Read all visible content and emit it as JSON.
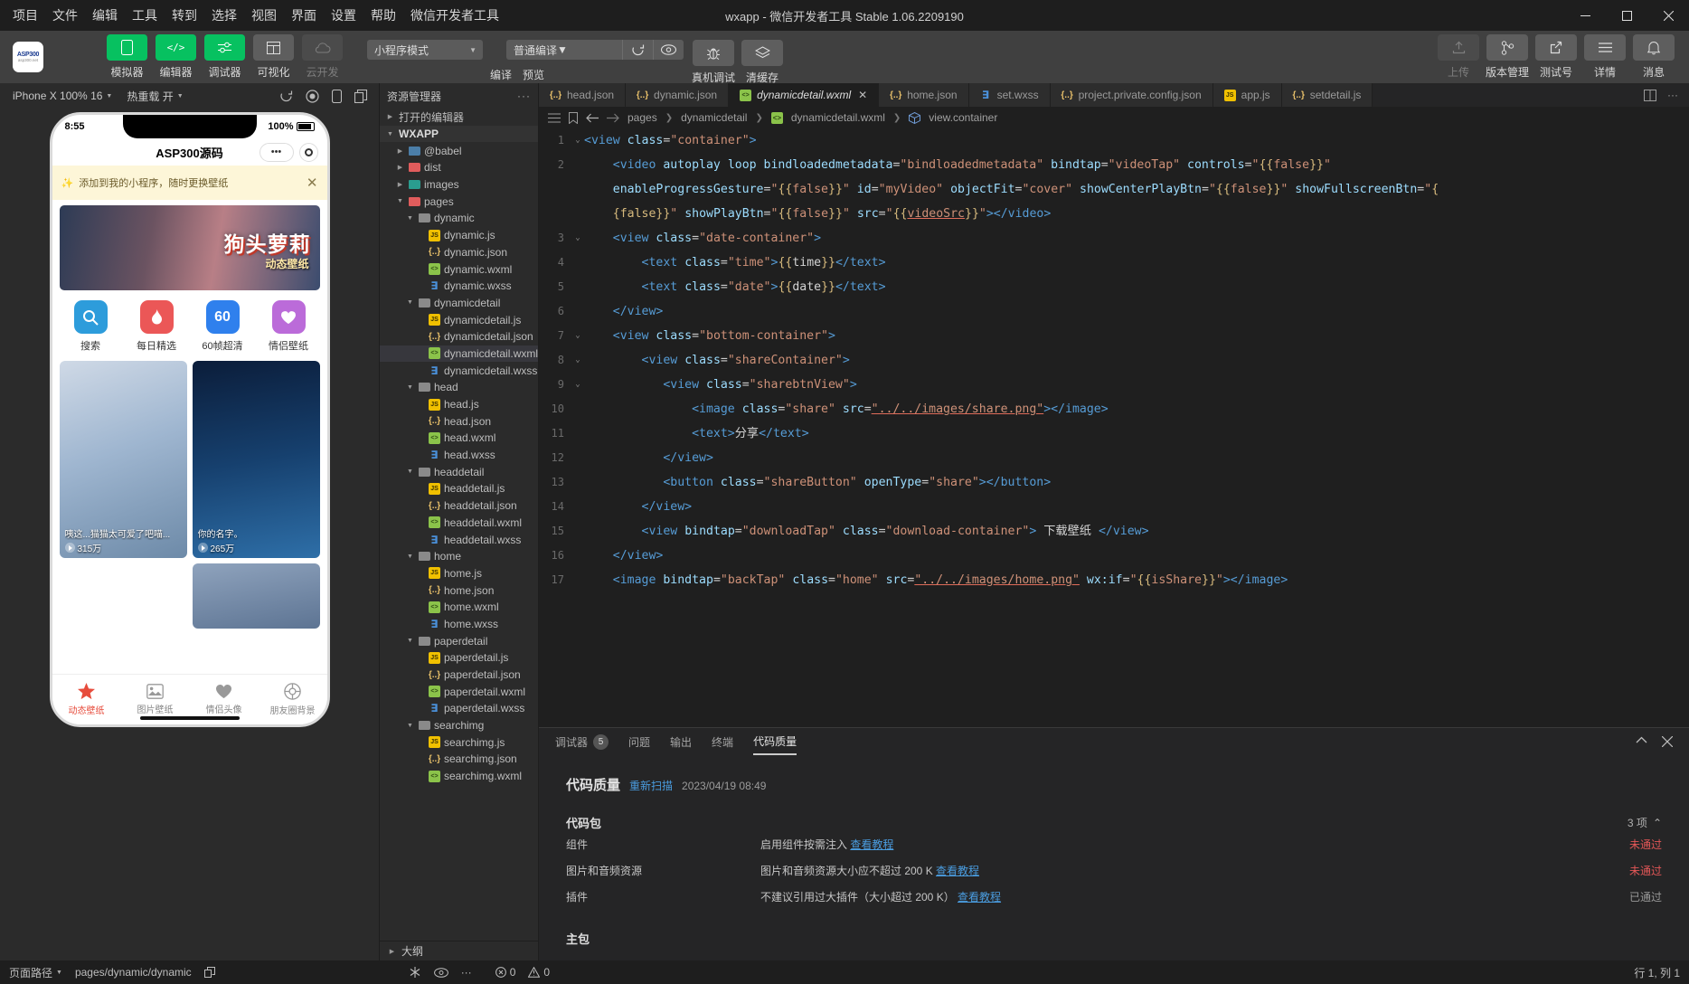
{
  "window": {
    "title": "wxapp - 微信开发者工具 Stable 1.06.2209190",
    "menu": [
      "项目",
      "文件",
      "编辑",
      "工具",
      "转到",
      "选择",
      "视图",
      "界面",
      "设置",
      "帮助",
      "微信开发者工具"
    ],
    "controls": {
      "minimize": "—",
      "maximize": "▢",
      "close": "✕"
    }
  },
  "logo": {
    "line1": "ASP300",
    "line2": "asp300.net"
  },
  "toolbar": {
    "left_buttons": [
      {
        "label": "模拟器",
        "icon": "phone-icon",
        "state": "active"
      },
      {
        "label": "编辑器",
        "icon": "code-icon",
        "state": "active"
      },
      {
        "label": "调试器",
        "icon": "sliders-icon",
        "state": "active"
      },
      {
        "label": "可视化",
        "icon": "layout-icon",
        "state": "normal"
      },
      {
        "label": "云开发",
        "icon": "cloud-icon",
        "state": "disabled"
      }
    ],
    "mode_select": "小程序模式",
    "compile_select": "普通编译",
    "mid_labels": [
      "编译",
      "预览",
      "真机调试",
      "清缓存"
    ],
    "debug_label": "真机调试",
    "cache_label": "清缓存",
    "right_buttons": [
      {
        "label": "上传",
        "icon": "upload-icon",
        "state": "disabled"
      },
      {
        "label": "版本管理",
        "icon": "branch-icon",
        "state": "normal"
      },
      {
        "label": "测试号",
        "icon": "external-link-icon",
        "state": "normal"
      },
      {
        "label": "详情",
        "icon": "menu-icon",
        "state": "normal"
      },
      {
        "label": "消息",
        "icon": "bell-icon",
        "state": "normal"
      }
    ]
  },
  "simulator": {
    "device": "iPhone X 100% 16",
    "hot_reload": "热重载 开",
    "icons": [
      "rotate-icon",
      "record-icon",
      "phone-icon",
      "copy-icon"
    ],
    "phone": {
      "time": "8:55",
      "battery": "100%",
      "nav_title": "ASP300源码",
      "tip_text": "添加到我的小程序，随时更换壁纸",
      "banner_title": "狗头萝莉",
      "banner_sub": "动态壁纸",
      "quick": [
        {
          "label": "搜索",
          "icon": "search-icon",
          "color": "#2d9cdb"
        },
        {
          "label": "每日精选",
          "icon": "flame-icon",
          "color": "#eb5757"
        },
        {
          "label": "60帧超清",
          "icon": "sixty-icon",
          "color": "#2f80ed"
        },
        {
          "label": "情侣壁纸",
          "icon": "heart-icon",
          "color": "#bb6bd9"
        }
      ],
      "cards": [
        {
          "title": "咦这...猫猫太可爱了吧喵...",
          "plays": "315万",
          "grad": "linear-gradient(160deg,#cfd9e6,#9fb6d0 45%,#6d8aa8)"
        },
        {
          "title": "你的名字。",
          "plays": "265万",
          "grad": "linear-gradient(170deg,#0b1d3a,#16406e 50%,#2e6fa8)"
        },
        {
          "title": "",
          "plays": "",
          "grad": "linear-gradient(170deg,#8fa3bd,#5d7493)"
        }
      ],
      "tabbar": [
        {
          "label": "动态壁纸",
          "icon": "wallpaper-icon",
          "active": true
        },
        {
          "label": "图片壁纸",
          "icon": "image-icon",
          "active": false
        },
        {
          "label": "情侣头像",
          "icon": "heart-icon",
          "active": false
        },
        {
          "label": "朋友圈背景",
          "icon": "circle-icon",
          "active": false
        }
      ]
    }
  },
  "explorer": {
    "title": "资源管理器",
    "more": "···",
    "open_editors": "打开的编辑器",
    "root": "WXAPP",
    "outline": "大纲",
    "tree": [
      {
        "label": "@babel",
        "type": "folder",
        "depth": 1,
        "open": false,
        "color": "#4b7ea8"
      },
      {
        "label": "dist",
        "type": "folder",
        "depth": 1,
        "open": false,
        "color": "#e05c5c"
      },
      {
        "label": "images",
        "type": "folder",
        "depth": 1,
        "open": false,
        "color": "#2a9d8f"
      },
      {
        "label": "pages",
        "type": "folder",
        "depth": 1,
        "open": true,
        "color": "#e05c5c"
      },
      {
        "label": "dynamic",
        "type": "folder",
        "depth": 2,
        "open": true,
        "color": "#8a8a8a"
      },
      {
        "label": "dynamic.js",
        "type": "js",
        "depth": 3
      },
      {
        "label": "dynamic.json",
        "type": "json",
        "depth": 3
      },
      {
        "label": "dynamic.wxml",
        "type": "wxml",
        "depth": 3
      },
      {
        "label": "dynamic.wxss",
        "type": "wxss",
        "depth": 3
      },
      {
        "label": "dynamicdetail",
        "type": "folder",
        "depth": 2,
        "open": true,
        "color": "#8a8a8a"
      },
      {
        "label": "dynamicdetail.js",
        "type": "js",
        "depth": 3
      },
      {
        "label": "dynamicdetail.json",
        "type": "json",
        "depth": 3
      },
      {
        "label": "dynamicdetail.wxml",
        "type": "wxml",
        "depth": 3,
        "selected": true
      },
      {
        "label": "dynamicdetail.wxss",
        "type": "wxss",
        "depth": 3
      },
      {
        "label": "head",
        "type": "folder",
        "depth": 2,
        "open": true,
        "color": "#8a8a8a"
      },
      {
        "label": "head.js",
        "type": "js",
        "depth": 3
      },
      {
        "label": "head.json",
        "type": "json",
        "depth": 3
      },
      {
        "label": "head.wxml",
        "type": "wxml",
        "depth": 3
      },
      {
        "label": "head.wxss",
        "type": "wxss",
        "depth": 3
      },
      {
        "label": "headdetail",
        "type": "folder",
        "depth": 2,
        "open": true,
        "color": "#8a8a8a"
      },
      {
        "label": "headdetail.js",
        "type": "js",
        "depth": 3
      },
      {
        "label": "headdetail.json",
        "type": "json",
        "depth": 3
      },
      {
        "label": "headdetail.wxml",
        "type": "wxml",
        "depth": 3
      },
      {
        "label": "headdetail.wxss",
        "type": "wxss",
        "depth": 3
      },
      {
        "label": "home",
        "type": "folder",
        "depth": 2,
        "open": true,
        "color": "#8a8a8a"
      },
      {
        "label": "home.js",
        "type": "js",
        "depth": 3
      },
      {
        "label": "home.json",
        "type": "json",
        "depth": 3
      },
      {
        "label": "home.wxml",
        "type": "wxml",
        "depth": 3
      },
      {
        "label": "home.wxss",
        "type": "wxss",
        "depth": 3
      },
      {
        "label": "paperdetail",
        "type": "folder",
        "depth": 2,
        "open": true,
        "color": "#8a8a8a"
      },
      {
        "label": "paperdetail.js",
        "type": "js",
        "depth": 3
      },
      {
        "label": "paperdetail.json",
        "type": "json",
        "depth": 3
      },
      {
        "label": "paperdetail.wxml",
        "type": "wxml",
        "depth": 3
      },
      {
        "label": "paperdetail.wxss",
        "type": "wxss",
        "depth": 3
      },
      {
        "label": "searchimg",
        "type": "folder",
        "depth": 2,
        "open": true,
        "color": "#8a8a8a"
      },
      {
        "label": "searchimg.js",
        "type": "js",
        "depth": 3
      },
      {
        "label": "searchimg.json",
        "type": "json",
        "depth": 3
      },
      {
        "label": "searchimg.wxml",
        "type": "wxml",
        "depth": 3
      }
    ]
  },
  "editor": {
    "tabs": [
      {
        "label": "head.json",
        "type": "json",
        "active": false
      },
      {
        "label": "dynamic.json",
        "type": "json",
        "active": false
      },
      {
        "label": "dynamicdetail.wxml",
        "type": "wxml",
        "active": true,
        "close": "✕"
      },
      {
        "label": "home.json",
        "type": "json",
        "active": false
      },
      {
        "label": "set.wxss",
        "type": "wxss",
        "active": false
      },
      {
        "label": "project.private.config.json",
        "type": "json",
        "active": false
      },
      {
        "label": "app.js",
        "type": "js",
        "active": false
      },
      {
        "label": "setdetail.js",
        "type": "json",
        "active": false
      }
    ],
    "tab_tools": [
      "split-editor-icon",
      "more-icon"
    ],
    "breadcrumb": [
      "pages",
      "dynamicdetail",
      "dynamicdetail.wxml",
      "view.container"
    ],
    "breadcrumb_icons": [
      "list-icon",
      "bookmark-icon",
      "arrow-left-icon",
      "arrow-right-icon"
    ],
    "lines": [
      {
        "n": "1",
        "fold": "⌄",
        "html": "<span class='t-tag'>&lt;view</span> <span class='t-attr'>class</span>=<span class='t-str'>\"container\"</span><span class='t-tag'>&gt;</span>"
      },
      {
        "n": "2",
        "fold": "",
        "html": "&nbsp;&nbsp;&nbsp;&nbsp;<span class='t-tag'>&lt;video</span> <span class='t-attr'>autoplay loop bindloadedmetadata</span>=<span class='t-str'>\"bindloadedmetadata\"</span> <span class='t-attr'>bindtap</span>=<span class='t-str'>\"videoTap\"</span> <span class='t-attr'>controls</span>=<span class='t-str'>\"</span><span class='t-br'>{{</span><span class='t-str'>false</span><span class='t-br'>}}</span><span class='t-str'>\"</span>"
      },
      {
        "n": "",
        "fold": "",
        "html": "&nbsp;&nbsp;&nbsp;&nbsp;<span class='t-attr'>enableProgressGesture</span>=<span class='t-str'>\"</span><span class='t-br'>{{</span><span class='t-str'>false</span><span class='t-br'>}}</span><span class='t-str'>\"</span> <span class='t-attr'>id</span>=<span class='t-str'>\"myVideo\"</span> <span class='t-attr'>objectFit</span>=<span class='t-str'>\"cover\"</span> <span class='t-attr'>showCenterPlayBtn</span>=<span class='t-str'>\"</span><span class='t-br'>{{</span><span class='t-str'>false</span><span class='t-br'>}}</span><span class='t-str'>\"</span> <span class='t-attr'>showFullscreenBtn</span>=<span class='t-str'>\"</span><span class='t-br'>{</span>"
      },
      {
        "n": "",
        "fold": "",
        "html": "&nbsp;&nbsp;&nbsp;&nbsp;<span class='t-br'>{false}}</span><span class='t-str'>\"</span> <span class='t-attr'>showPlayBtn</span>=<span class='t-str'>\"</span><span class='t-br'>{{</span><span class='t-str'>false</span><span class='t-br'>}}</span><span class='t-str'>\"</span> <span class='t-attr'>src</span>=<span class='t-str'>\"</span><span class='t-br'>{{</span><span class='t-str und'>videoSrc</span><span class='t-br'>}}</span><span class='t-str'>\"</span><span class='t-tag'>&gt;&lt;/video&gt;</span>"
      },
      {
        "n": "3",
        "fold": "⌄",
        "html": "&nbsp;&nbsp;&nbsp;&nbsp;<span class='t-tag'>&lt;view</span> <span class='t-attr'>class</span>=<span class='t-str'>\"date-container\"</span><span class='t-tag'>&gt;</span>"
      },
      {
        "n": "4",
        "fold": "",
        "html": "&nbsp;&nbsp;&nbsp;&nbsp;&nbsp;&nbsp;&nbsp;&nbsp;<span class='t-tag'>&lt;text</span> <span class='t-attr'>class</span>=<span class='t-str'>\"time\"</span><span class='t-tag'>&gt;</span><span class='t-br'>{{</span><span class='t-txt'>time</span><span class='t-br'>}}</span><span class='t-tag'>&lt;/text&gt;</span>"
      },
      {
        "n": "5",
        "fold": "",
        "html": "&nbsp;&nbsp;&nbsp;&nbsp;&nbsp;&nbsp;&nbsp;&nbsp;<span class='t-tag'>&lt;text</span> <span class='t-attr'>class</span>=<span class='t-str'>\"date\"</span><span class='t-tag'>&gt;</span><span class='t-br'>{{</span><span class='t-txt'>date</span><span class='t-br'>}}</span><span class='t-tag'>&lt;/text&gt;</span>"
      },
      {
        "n": "6",
        "fold": "",
        "html": "&nbsp;&nbsp;&nbsp;&nbsp;<span class='t-tag'>&lt;/view&gt;</span>"
      },
      {
        "n": "7",
        "fold": "⌄",
        "html": "&nbsp;&nbsp;&nbsp;&nbsp;<span class='t-tag'>&lt;view</span> <span class='t-attr'>class</span>=<span class='t-str'>\"bottom-container\"</span><span class='t-tag'>&gt;</span>"
      },
      {
        "n": "8",
        "fold": "⌄",
        "html": "&nbsp;&nbsp;&nbsp;&nbsp;&nbsp;&nbsp;&nbsp;&nbsp;<span class='t-tag'>&lt;view</span> <span class='t-attr'>class</span>=<span class='t-str'>\"shareContainer\"</span><span class='t-tag'>&gt;</span>"
      },
      {
        "n": "9",
        "fold": "⌄",
        "html": "&nbsp;&nbsp;&nbsp;&nbsp;&nbsp;&nbsp;&nbsp;&nbsp;&nbsp;&nbsp;&nbsp;<span class='t-tag'>&lt;view</span> <span class='t-attr'>class</span>=<span class='t-str'>\"sharebtnView\"</span><span class='t-tag'>&gt;</span>"
      },
      {
        "n": "10",
        "fold": "",
        "html": "&nbsp;&nbsp;&nbsp;&nbsp;&nbsp;&nbsp;&nbsp;&nbsp;&nbsp;&nbsp;&nbsp;&nbsp;&nbsp;&nbsp;&nbsp;<span class='t-tag'>&lt;image</span> <span class='t-attr'>class</span>=<span class='t-str'>\"share\"</span> <span class='t-attr'>src</span>=<span class='t-str und'>\"../../images/share.png\"</span><span class='t-tag'>&gt;&lt;/image&gt;</span>"
      },
      {
        "n": "11",
        "fold": "",
        "html": "&nbsp;&nbsp;&nbsp;&nbsp;&nbsp;&nbsp;&nbsp;&nbsp;&nbsp;&nbsp;&nbsp;&nbsp;&nbsp;&nbsp;&nbsp;<span class='t-tag'>&lt;text&gt;</span><span class='t-txt'>分享</span><span class='t-tag'>&lt;/text&gt;</span>"
      },
      {
        "n": "12",
        "fold": "",
        "html": "&nbsp;&nbsp;&nbsp;&nbsp;&nbsp;&nbsp;&nbsp;&nbsp;&nbsp;&nbsp;&nbsp;<span class='t-tag'>&lt;/view&gt;</span>"
      },
      {
        "n": "13",
        "fold": "",
        "html": "&nbsp;&nbsp;&nbsp;&nbsp;&nbsp;&nbsp;&nbsp;&nbsp;&nbsp;&nbsp;&nbsp;<span class='t-tag'>&lt;button</span> <span class='t-attr'>class</span>=<span class='t-str'>\"shareButton\"</span> <span class='t-attr'>openType</span>=<span class='t-str'>\"share\"</span><span class='t-tag'>&gt;&lt;/button&gt;</span>"
      },
      {
        "n": "14",
        "fold": "",
        "html": "&nbsp;&nbsp;&nbsp;&nbsp;&nbsp;&nbsp;&nbsp;&nbsp;<span class='t-tag'>&lt;/view&gt;</span>"
      },
      {
        "n": "15",
        "fold": "",
        "html": "&nbsp;&nbsp;&nbsp;&nbsp;&nbsp;&nbsp;&nbsp;&nbsp;<span class='t-tag'>&lt;view</span> <span class='t-attr'>bindtap</span>=<span class='t-str'>\"downloadTap\"</span> <span class='t-attr'>class</span>=<span class='t-str'>\"download-container\"</span><span class='t-tag'>&gt;</span> <span class='t-txt'>下载壁纸</span> <span class='t-tag'>&lt;/view&gt;</span>"
      },
      {
        "n": "16",
        "fold": "",
        "html": "&nbsp;&nbsp;&nbsp;&nbsp;<span class='t-tag'>&lt;/view&gt;</span>"
      },
      {
        "n": "17",
        "fold": "",
        "html": "&nbsp;&nbsp;&nbsp;&nbsp;<span class='t-tag'>&lt;image</span> <span class='t-attr'>bindtap</span>=<span class='t-str'>\"backTap\"</span> <span class='t-attr'>class</span>=<span class='t-str'>\"home\"</span> <span class='t-attr'>src</span>=<span class='t-str und'>\"../../images/home.png\"</span> <span class='t-attr'>wx:if</span>=<span class='t-str'>\"</span><span class='t-br'>{{</span><span class='t-str'>isShare</span><span class='t-br'>}}</span><span class='t-str'>\"</span><span class='t-tag'>&gt;&lt;/image&gt;</span>"
      }
    ]
  },
  "panel": {
    "tabs": [
      {
        "label": "调试器",
        "badge": "5",
        "active": false
      },
      {
        "label": "问题",
        "badge": "",
        "active": false
      },
      {
        "label": "输出",
        "badge": "",
        "active": false
      },
      {
        "label": "终端",
        "badge": "",
        "active": false
      },
      {
        "label": "代码质量",
        "badge": "",
        "active": true
      }
    ],
    "controls": [
      "collapse-icon",
      "close-icon"
    ],
    "quality": {
      "title": "代码质量",
      "rescan": "重新扫描",
      "timestamp": "2023/04/19 08:49",
      "section1": {
        "name": "代码包",
        "count": "3 项"
      },
      "rows": [
        {
          "name": "组件",
          "desc": "启用组件按需注入",
          "link": "查看教程",
          "status": "未通过",
          "ok": false
        },
        {
          "name": "图片和音频资源",
          "desc": "图片和音频资源大小应不超过 200 K",
          "link": "查看教程",
          "status": "未通过",
          "ok": false
        },
        {
          "name": "插件",
          "desc": "不建议引用过大插件（大小超过 200 K）",
          "link": "查看教程",
          "status": "已通过",
          "ok": true
        }
      ],
      "section2": {
        "name": "主包",
        "count": ""
      }
    }
  },
  "status": {
    "page_path_label": "页面路径",
    "page_path": "pages/dynamic/dynamic",
    "errors": "0",
    "warnings": "0",
    "cursor": "行 1, 列 1",
    "icons": [
      "copy-icon",
      "settings-icon",
      "eye-icon",
      "more-icon",
      "error-icon",
      "warning-icon"
    ]
  }
}
